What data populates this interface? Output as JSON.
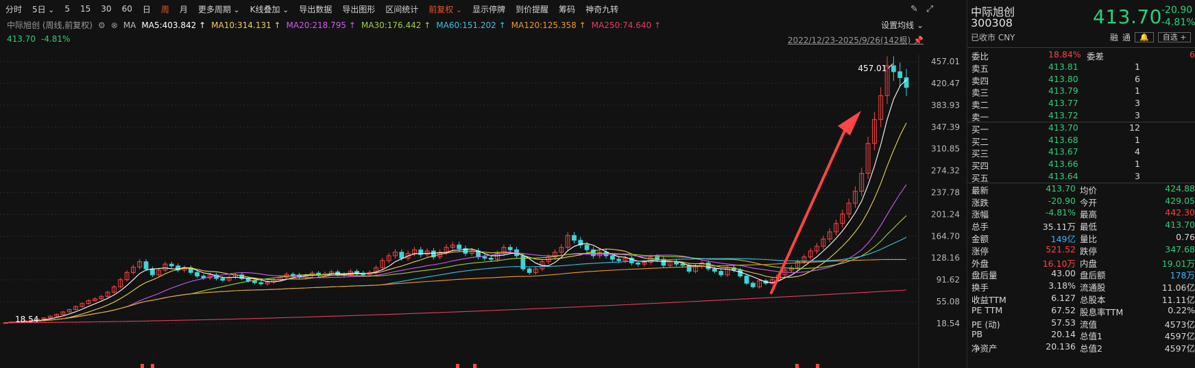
{
  "toolbar": {
    "items": [
      "分时",
      "5日",
      "5",
      "15",
      "30",
      "60",
      "日",
      "周",
      "月",
      "更多周期",
      "K线叠加",
      "导出数据",
      "导出图形",
      "区间统计",
      "前复权",
      "显示停牌",
      "到价提醒",
      "筹码",
      "神奇九转"
    ],
    "active": "周"
  },
  "info": {
    "title": "中际旭创 (周线,前复权)",
    "ma_label": "MA",
    "set_ma": "设置均线",
    "date_range": "2022/12/23-2025/9/26(142根)",
    "last_price": "413.70",
    "last_pct": "-4.81%"
  },
  "ma": [
    {
      "label": "MA5:403.842",
      "color": "#ffffff"
    },
    {
      "label": "MA10:314.131",
      "color": "#f0d060"
    },
    {
      "label": "MA20:218.795",
      "color": "#d05cf0"
    },
    {
      "label": "MA30:176.442",
      "color": "#a0d040"
    },
    {
      "label": "MA60:151.202",
      "color": "#40c0e0"
    },
    {
      "label": "MA120:125.358",
      "color": "#f09a30"
    },
    {
      "label": "MA250:74.640",
      "color": "#e04060"
    }
  ],
  "chart_data": {
    "type": "candlestick",
    "y_ticks": [
      "457.01",
      "420.47",
      "383.93",
      "347.39",
      "310.85",
      "274.32",
      "237.78",
      "201.24",
      "164.70",
      "128.16",
      "91.62",
      "55.08",
      "18.54"
    ],
    "ylim": [
      18.54,
      457.01
    ],
    "high_label": "457.01",
    "low_label": "18.54",
    "closes": [
      20,
      21,
      22,
      23,
      24,
      26,
      28,
      31,
      34,
      38,
      42,
      47,
      52,
      57,
      60,
      64,
      71,
      80,
      92,
      104,
      113,
      122,
      110,
      100,
      108,
      118,
      115,
      108,
      112,
      104,
      98,
      95,
      100,
      94,
      91,
      96,
      100,
      94,
      90,
      87,
      85,
      88,
      92,
      96,
      101,
      100,
      96,
      99,
      103,
      100,
      102,
      105,
      101,
      100,
      106,
      103,
      100,
      104,
      112,
      124,
      132,
      138,
      128,
      136,
      142,
      134,
      140,
      130,
      138,
      146,
      150,
      144,
      136,
      140,
      130,
      128,
      126,
      136,
      146,
      142,
      132,
      110,
      104,
      110,
      122,
      130,
      138,
      146,
      166,
      158,
      150,
      142,
      132,
      138,
      132,
      126,
      124,
      128,
      120,
      118,
      121,
      130,
      126,
      116,
      122,
      118,
      116,
      106,
      114,
      120,
      110,
      106,
      100,
      112,
      108,
      98,
      86,
      80,
      90,
      86,
      92,
      100,
      108,
      112,
      122,
      130,
      140,
      148,
      160,
      172,
      186,
      202,
      220,
      240,
      270,
      320,
      360,
      400,
      450,
      440,
      430,
      413.7
    ],
    "ma_final": [
      403.842,
      314.131,
      218.795,
      176.442,
      151.202,
      125.358,
      74.64
    ]
  },
  "quote": {
    "name": "中际旭创",
    "code": "300308",
    "status": "已收市 CNY",
    "price": "413.70",
    "change": "-20.90",
    "pct": "-4.81%",
    "tags": [
      "融",
      "通",
      "自选 +"
    ],
    "weibi": {
      "label": "委比",
      "value": "18.84%",
      "label2": "委差",
      "value2": "6"
    },
    "asks": [
      {
        "label": "卖五",
        "price": "413.81",
        "vol": "1"
      },
      {
        "label": "卖四",
        "price": "413.80",
        "vol": "6"
      },
      {
        "label": "卖三",
        "price": "413.79",
        "vol": "1"
      },
      {
        "label": "卖二",
        "price": "413.77",
        "vol": "3"
      },
      {
        "label": "卖一",
        "price": "413.72",
        "vol": "3"
      }
    ],
    "bids": [
      {
        "label": "买一",
        "price": "413.70",
        "vol": "12"
      },
      {
        "label": "买二",
        "price": "413.68",
        "vol": "1"
      },
      {
        "label": "买三",
        "price": "413.67",
        "vol": "4"
      },
      {
        "label": "买四",
        "price": "413.66",
        "vol": "1"
      },
      {
        "label": "买五",
        "price": "413.64",
        "vol": "3"
      }
    ],
    "stats": [
      {
        "l1": "最新",
        "v1": "413.70",
        "c1": "green",
        "l2": "均价",
        "v2": "424.88",
        "c2": "green"
      },
      {
        "l1": "涨跌",
        "v1": "-20.90",
        "c1": "green",
        "l2": "今开",
        "v2": "429.05",
        "c2": "green"
      },
      {
        "l1": "涨幅",
        "v1": "-4.81%",
        "c1": "green",
        "l2": "最高",
        "v2": "442.30",
        "c2": "red"
      },
      {
        "l1": "总手",
        "v1": "35.11万",
        "c1": "white",
        "l2": "最低",
        "v2": "413.70",
        "c2": "green"
      },
      {
        "l1": "金额",
        "v1": "149亿",
        "c1": "cyan",
        "l2": "量比",
        "v2": "0.76",
        "c2": "white"
      },
      {
        "l1": "涨停",
        "v1": "521.52",
        "c1": "red",
        "l2": "跌停",
        "v2": "347.68",
        "c2": "green"
      },
      {
        "l1": "外盘",
        "v1": "16.10万",
        "c1": "red",
        "l2": "内盘",
        "v2": "19.01万",
        "c2": "green"
      },
      {
        "l1": "盘后量",
        "v1": "43.00",
        "c1": "white",
        "l2": "盘后额",
        "v2": "178万",
        "c2": "cyan"
      },
      {
        "l1": "换手",
        "v1": "3.18%",
        "c1": "white",
        "l2": "流通股",
        "v2": "11.06亿",
        "c2": "white"
      },
      {
        "l1": "收益TTM",
        "v1": "6.127",
        "c1": "white",
        "l2": "总股本",
        "v2": "11.11亿",
        "c2": "white"
      },
      {
        "l1": "PE TTM",
        "v1": "67.52",
        "c1": "white",
        "l2": "股息率TTM",
        "v2": "0.22%",
        "c2": "white"
      },
      {
        "l1": "PE (动)",
        "v1": "57.53",
        "c1": "white",
        "l2": "流值",
        "v2": "4573亿",
        "c2": "white"
      },
      {
        "l1": "PB",
        "v1": "20.14",
        "c1": "white",
        "l2": "总值1",
        "v2": "4597亿",
        "c2": "white"
      },
      {
        "l1": "净资产",
        "v1": "20.136",
        "c1": "white",
        "l2": "总值2",
        "v2": "4597亿",
        "c2": "white"
      }
    ]
  }
}
